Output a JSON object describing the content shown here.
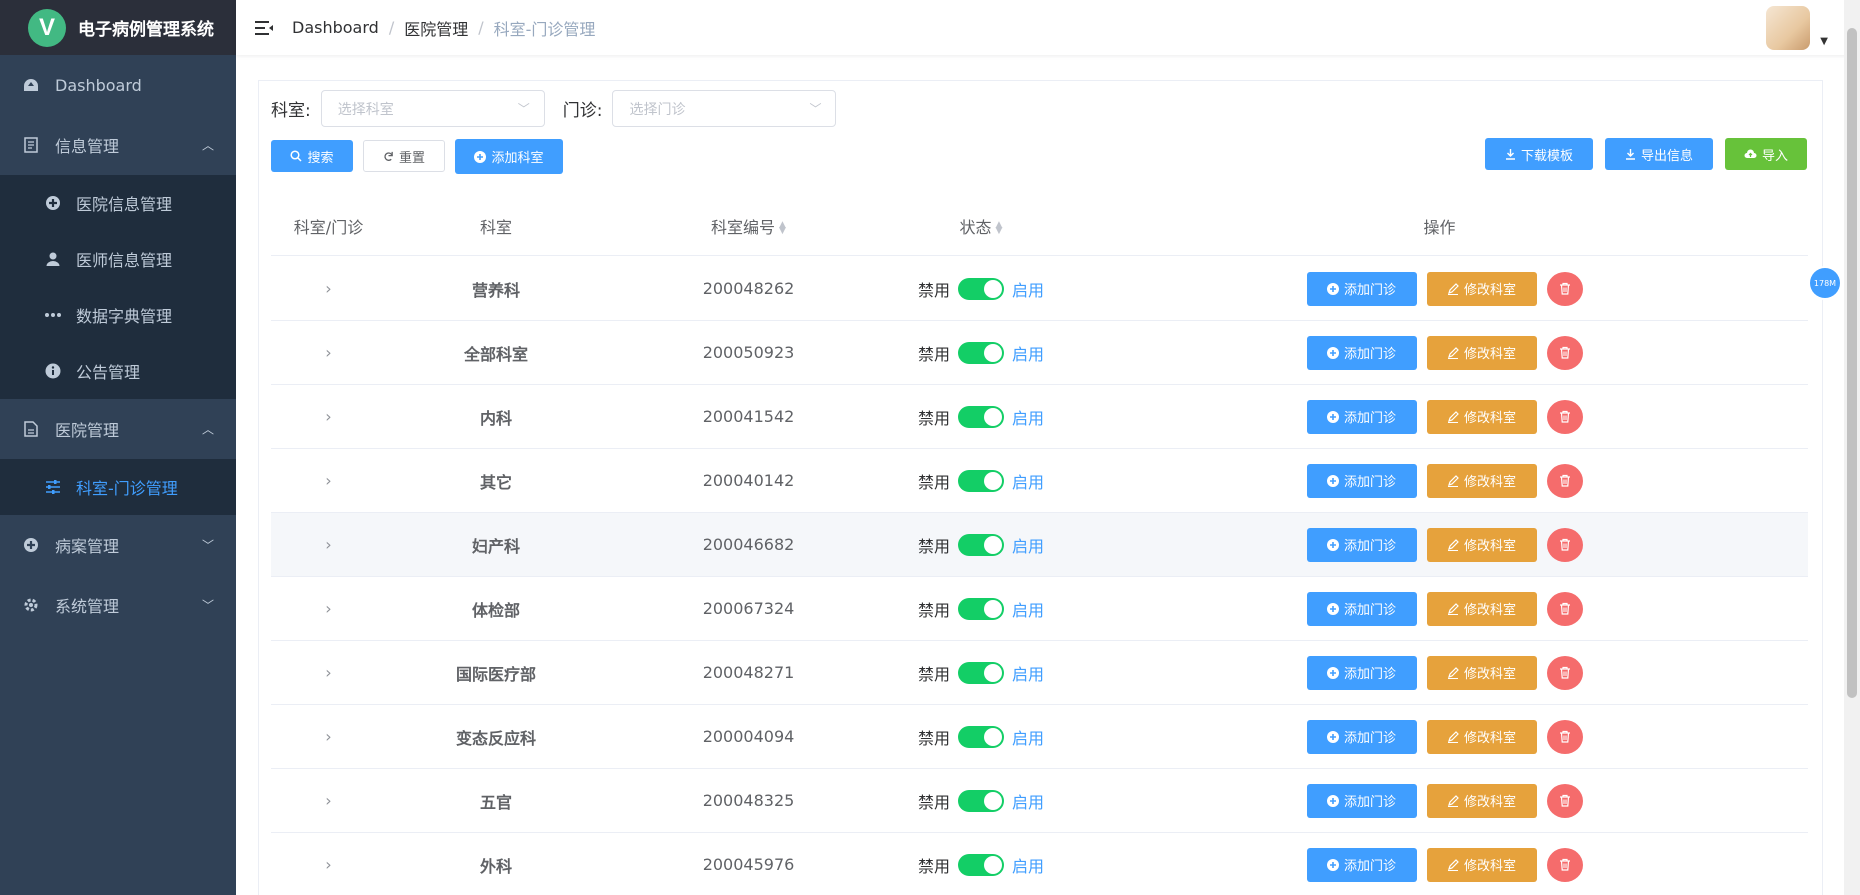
{
  "app": {
    "title": "电子病例管理系统",
    "logo_letter": "V"
  },
  "sidebar": {
    "dashboard": "Dashboard",
    "info_mgmt": "信息管理",
    "info_items": [
      "医院信息管理",
      "医师信息管理",
      "数据字典管理",
      "公告管理"
    ],
    "hospital_mgmt": "医院管理",
    "hospital_items": [
      "科室-门诊管理"
    ],
    "case_mgmt": "病案管理",
    "system_mgmt": "系统管理"
  },
  "breadcrumb": [
    "Dashboard",
    "医院管理",
    "科室-门诊管理"
  ],
  "filters": {
    "dept_label": "科室:",
    "dept_placeholder": "选择科室",
    "clinic_label": "门诊:",
    "clinic_placeholder": "选择门诊"
  },
  "toolbar": {
    "search": "搜索",
    "reset": "重置",
    "add_dept": "添加科室",
    "download_template": "下载模板",
    "export": "导出信息",
    "import": "导入"
  },
  "table": {
    "headers": [
      "科室/门诊",
      "科室",
      "科室编号",
      "状态",
      "操作"
    ],
    "status_off": "禁用",
    "status_on": "启用",
    "add_clinic": "添加门诊",
    "edit_dept": "修改科室",
    "rows": [
      {
        "name": "营养科",
        "code": "200048262"
      },
      {
        "name": "全部科室",
        "code": "200050923"
      },
      {
        "name": "内科",
        "code": "200041542"
      },
      {
        "name": "其它",
        "code": "200040142"
      },
      {
        "name": "妇产科",
        "code": "200046682"
      },
      {
        "name": "体检部",
        "code": "200067324"
      },
      {
        "name": "国际医疗部",
        "code": "200048271"
      },
      {
        "name": "变态反应科",
        "code": "200004094"
      },
      {
        "name": "五官",
        "code": "200048325"
      },
      {
        "name": "外科",
        "code": "200045976"
      }
    ]
  },
  "floating_badge": "178M",
  "colors": {
    "primary": "#409eff",
    "success": "#67c23a",
    "warning": "#e6a23c",
    "danger": "#f56c6c",
    "sidebar": "#304156"
  }
}
